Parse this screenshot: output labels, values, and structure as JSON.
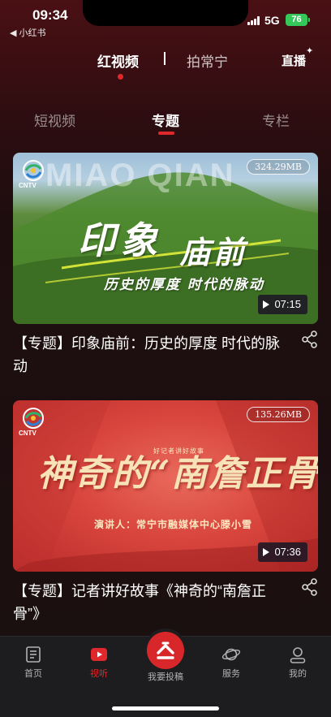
{
  "status_bar": {
    "time": "09:34",
    "back_app": "◀ 小红书",
    "network": "5G",
    "battery": "76"
  },
  "top_tabs": {
    "primary": "红视频",
    "secondary": "拍常宁",
    "live": "直播"
  },
  "sub_tabs": [
    {
      "label": "短视频",
      "active": false
    },
    {
      "label": "专题",
      "active": true
    },
    {
      "label": "专栏",
      "active": false
    }
  ],
  "cards": [
    {
      "thumb_title_line1": "印象",
      "thumb_title_line2": "庙前",
      "thumb_subtitle": "历史的厚度 时代的脉动",
      "thumb_watermark": "MIAO QIAN",
      "logo_text": "CNTV",
      "size": "324.29MB",
      "duration": "07:15",
      "title": "【专题】印象庙前：历史的厚度 时代的脉动"
    },
    {
      "thumb_kicker": "好记者讲好故事",
      "thumb_title": "神奇的“南詹正骨”",
      "thumb_speaker": "演讲人：常宁市融媒体中心滕小雪",
      "logo_text": "CNTV",
      "size": "135.26MB",
      "duration": "07:36",
      "title": "【专题】记者讲好故事《神奇的“南詹正骨”》"
    }
  ],
  "bottom_nav": [
    {
      "label": "首页",
      "icon": "home-doc-icon",
      "active": false
    },
    {
      "label": "视听",
      "icon": "video-play-icon",
      "active": true
    },
    {
      "label": "我要投稿",
      "icon": "upload-icon",
      "active": false
    },
    {
      "label": "服务",
      "icon": "planet-icon",
      "active": false
    },
    {
      "label": "我的",
      "icon": "user-icon",
      "active": false
    }
  ],
  "colors": {
    "accent": "#e0282c",
    "background": "#1a1010"
  }
}
